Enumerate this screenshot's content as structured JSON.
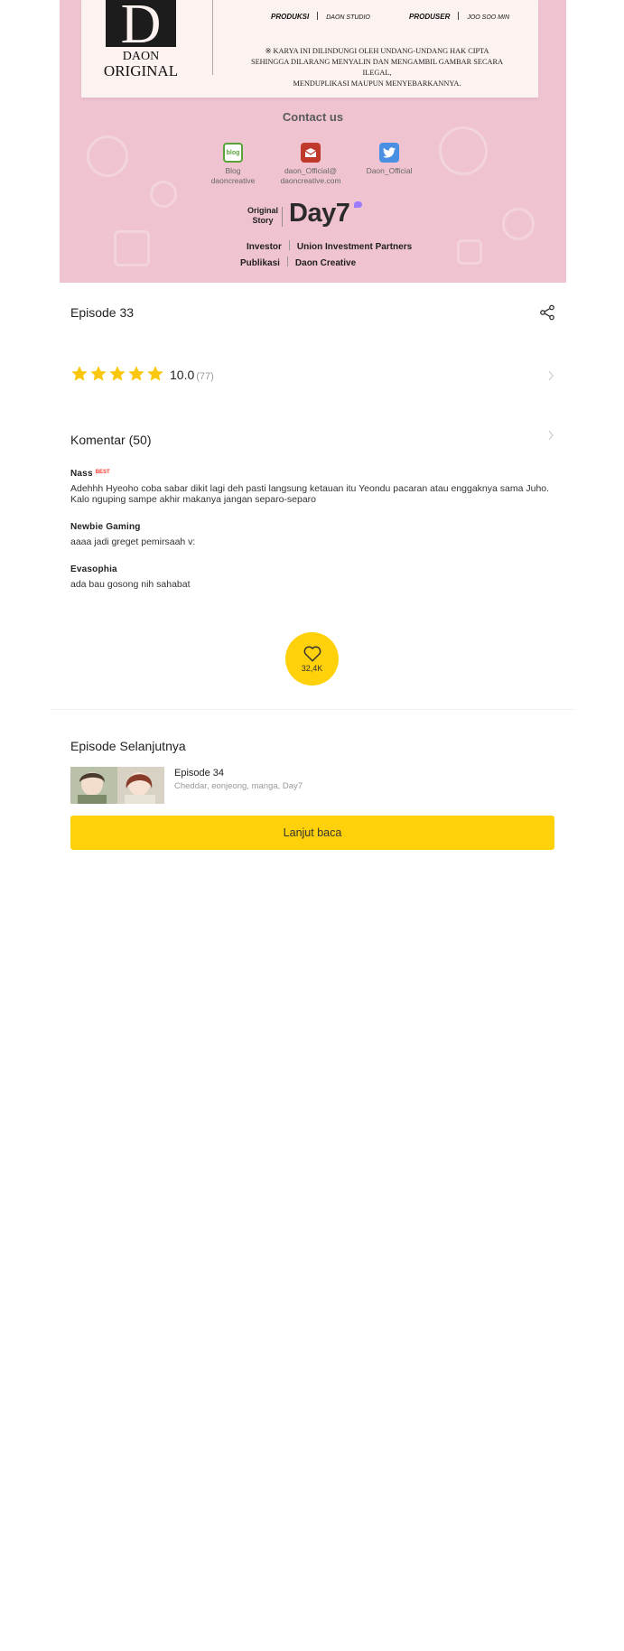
{
  "banner": {
    "logo": {
      "mark": "D",
      "line1": "DAON",
      "line2": "ORIGINAL"
    },
    "credits": [
      {
        "label": "PRODUKSI",
        "value": "DAON STUDIO"
      },
      {
        "label": "PRODUSER",
        "value": "JOO SOO MIN"
      }
    ],
    "copyright": [
      "※ KARYA INI DILINDUNGI OLEH UNDANG-UNDANG HAK CIPTA",
      "SEHINGGA DILARANG MENYALIN DAN MENGAMBIL GAMBAR SECARA ILEGAL,",
      "MENDUPLIKASI MAUPUN MENYEBARKANNYA."
    ],
    "contact_title": "Contact us",
    "contacts": [
      {
        "icon": "blog-icon",
        "badge": "blog",
        "line1": "Blog",
        "line2": "daoncreative",
        "color": "#5aa33b"
      },
      {
        "icon": "mail-icon",
        "line1": "daon_Official@",
        "line2": "daoncreative.com",
        "color": "#c0392b"
      },
      {
        "icon": "twitter-icon",
        "line1": "Daon_Official",
        "line2": "",
        "color": "#4a90e2"
      }
    ],
    "original_story_line1": "Original",
    "original_story_line2": "Story",
    "original_story_brand": "Day7",
    "investor_label": "Investor",
    "investor_value": "Union Investment Partners",
    "publikasi_label": "Publikasi",
    "publikasi_value": "Daon Creative",
    "bg_color": "#efc4d0"
  },
  "episode": {
    "title": "Episode 33",
    "rating_value": "10.0",
    "rating_count": "(77)",
    "stars_filled": 5,
    "stars_total": 5
  },
  "comments": {
    "title": "Komentar (50)",
    "items": [
      {
        "author": "Nass",
        "badge": "BEST",
        "text": "Adehhh Hyeoho coba sabar dikit lagi deh pasti langsung ketauan itu Yeondu pacaran atau enggaknya sama Juho. Kalo nguping sampe akhir makanya jangan separo-separo"
      },
      {
        "author": "Newbie Gaming",
        "badge": "",
        "text": "aaaa jadi greget pemirsaah v:"
      },
      {
        "author": "Evasophia",
        "badge": "",
        "text": "ada bau gosong nih sahabat"
      }
    ]
  },
  "like": {
    "count": "32,4K",
    "color": "#ffd10a"
  },
  "next": {
    "section_title": "Episode Selanjutnya",
    "episode_title": "Episode 34",
    "meta": "Cheddar, eonjeong, manga, Day7",
    "button_label": "Lanjut baca"
  }
}
